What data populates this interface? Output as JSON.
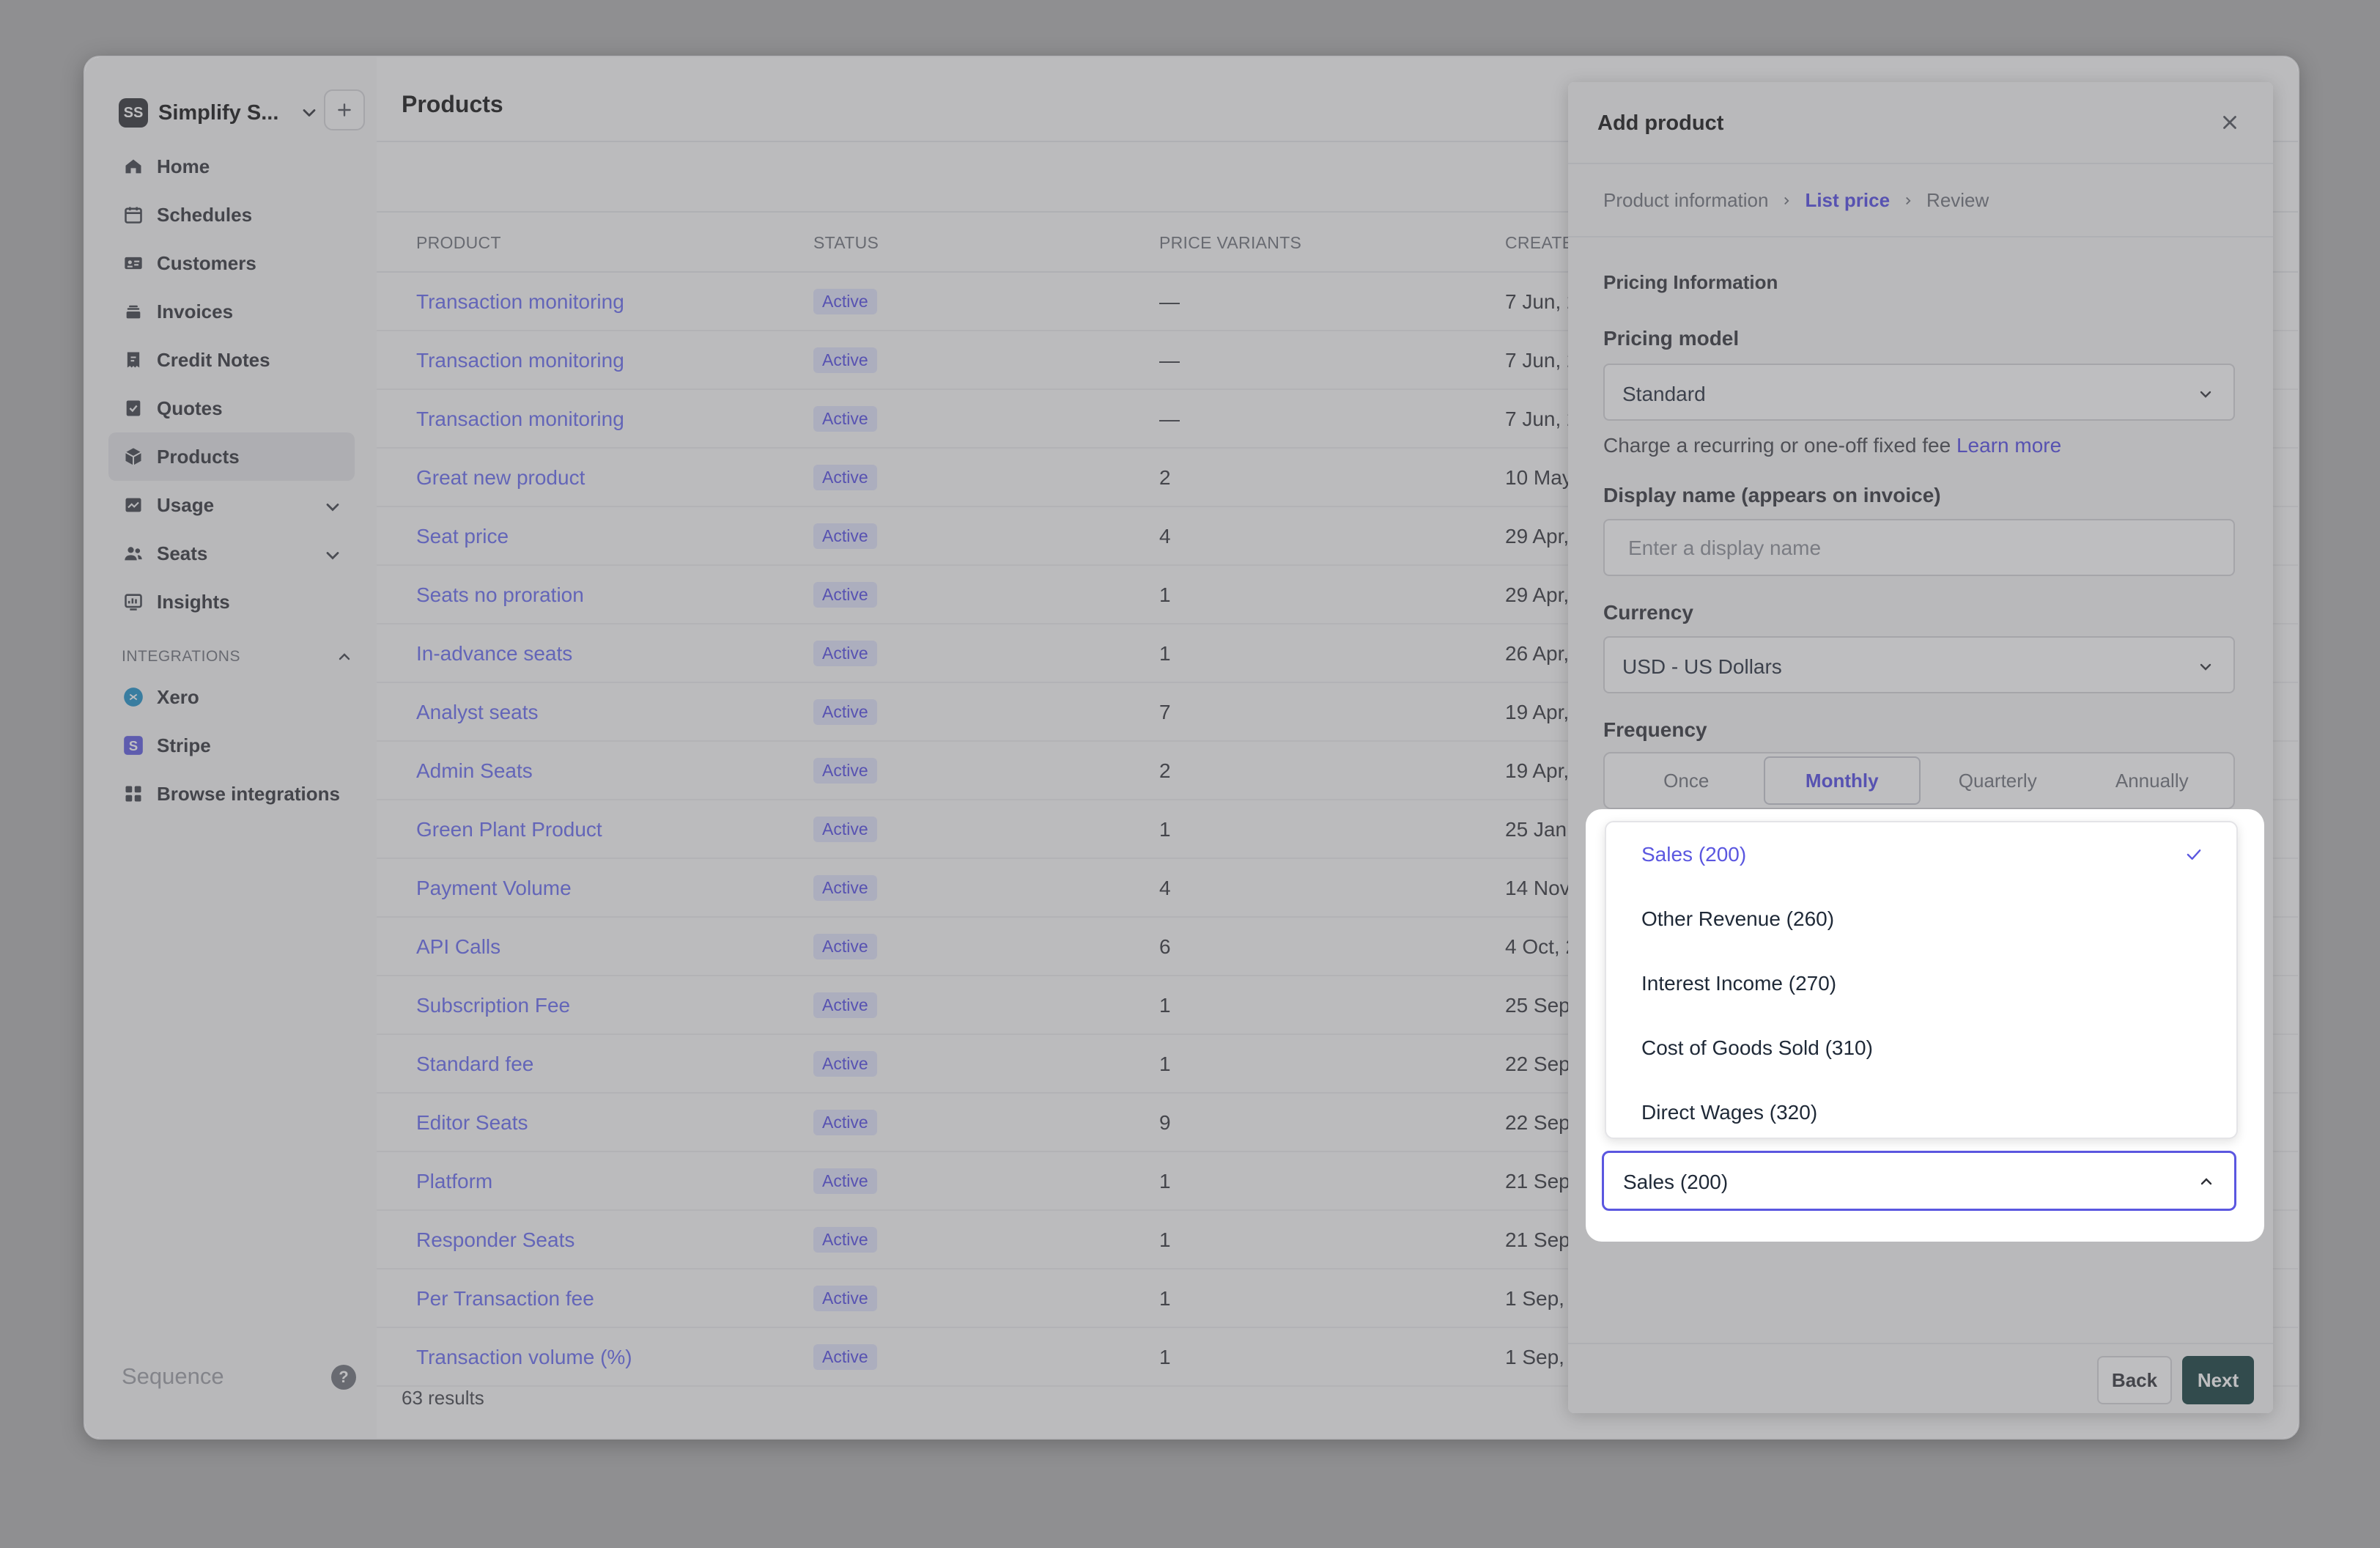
{
  "workspace": {
    "initials": "SS",
    "name": "Simplify S..."
  },
  "sidebar": {
    "items": [
      {
        "label": "Home",
        "icon": "home-icon"
      },
      {
        "label": "Schedules",
        "icon": "calendar-icon"
      },
      {
        "label": "Customers",
        "icon": "id-card-icon"
      },
      {
        "label": "Invoices",
        "icon": "invoice-stack-icon"
      },
      {
        "label": "Credit Notes",
        "icon": "credit-note-icon"
      },
      {
        "label": "Quotes",
        "icon": "quote-check-icon"
      },
      {
        "label": "Products",
        "icon": "cube-icon",
        "active": true
      },
      {
        "label": "Usage",
        "icon": "usage-chart-icon",
        "expandable": true
      },
      {
        "label": "Seats",
        "icon": "users-icon",
        "expandable": true
      },
      {
        "label": "Insights",
        "icon": "insights-icon"
      }
    ],
    "integrations_title": "INTEGRATIONS",
    "integrations": [
      {
        "label": "Xero",
        "icon": "xero-logo-icon"
      },
      {
        "label": "Stripe",
        "icon": "stripe-logo-icon"
      },
      {
        "label": "Browse integrations",
        "icon": "grid-icon"
      }
    ],
    "brand": "Sequence",
    "help": "?"
  },
  "main": {
    "title": "Products",
    "columns": [
      "PRODUCT",
      "STATUS",
      "PRICE VARIANTS",
      "CREATE"
    ],
    "rows": [
      {
        "name": "Transaction monitoring",
        "status": "Active",
        "variants": "—",
        "created": "7 Jun, 2"
      },
      {
        "name": "Transaction monitoring",
        "status": "Active",
        "variants": "—",
        "created": "7 Jun, 2"
      },
      {
        "name": "Transaction monitoring",
        "status": "Active",
        "variants": "—",
        "created": "7 Jun, 2"
      },
      {
        "name": "Great new product",
        "status": "Active",
        "variants": "2",
        "created": "10 May"
      },
      {
        "name": "Seat price",
        "status": "Active",
        "variants": "4",
        "created": "29 Apr,"
      },
      {
        "name": "Seats no proration",
        "status": "Active",
        "variants": "1",
        "created": "29 Apr,"
      },
      {
        "name": "In-advance seats",
        "status": "Active",
        "variants": "1",
        "created": "26 Apr,"
      },
      {
        "name": "Analyst seats",
        "status": "Active",
        "variants": "7",
        "created": "19 Apr,"
      },
      {
        "name": "Admin Seats",
        "status": "Active",
        "variants": "2",
        "created": "19 Apr,"
      },
      {
        "name": "Green Plant Product",
        "status": "Active",
        "variants": "1",
        "created": "25 Jan,"
      },
      {
        "name": "Payment Volume",
        "status": "Active",
        "variants": "4",
        "created": "14 Nov"
      },
      {
        "name": "API Calls",
        "status": "Active",
        "variants": "6",
        "created": "4 Oct, 2"
      },
      {
        "name": "Subscription Fee",
        "status": "Active",
        "variants": "1",
        "created": "25 Sep,"
      },
      {
        "name": "Standard fee",
        "status": "Active",
        "variants": "1",
        "created": "22 Sep,"
      },
      {
        "name": "Editor Seats",
        "status": "Active",
        "variants": "9",
        "created": "22 Sep,"
      },
      {
        "name": "Platform",
        "status": "Active",
        "variants": "1",
        "created": "21 Sep,"
      },
      {
        "name": "Responder Seats",
        "status": "Active",
        "variants": "1",
        "created": "21 Sep,"
      },
      {
        "name": "Per Transaction fee",
        "status": "Active",
        "variants": "1",
        "created": "1 Sep, 2"
      },
      {
        "name": "Transaction volume (%)",
        "status": "Active",
        "variants": "1",
        "created": "1 Sep, 2"
      }
    ],
    "results": "63 results"
  },
  "drawer": {
    "title": "Add product",
    "breadcrumb": [
      "Product information",
      "List price",
      "Review"
    ],
    "section_title": "Pricing Information",
    "pricing_model_label": "Pricing model",
    "pricing_model_value": "Standard",
    "hint_text": "Charge a recurring or one-off fixed fee",
    "hint_link": "Learn more",
    "display_name_label": "Display name (appears on invoice)",
    "display_name_placeholder": "Enter a display name",
    "currency_label": "Currency",
    "currency_value": "USD - US Dollars",
    "frequency_label": "Frequency",
    "frequency_options": [
      "Once",
      "Monthly",
      "Quarterly",
      "Annually"
    ],
    "frequency_selected": "Monthly",
    "back": "Back",
    "next": "Next"
  },
  "account_select": {
    "value": "Sales (200)",
    "options": [
      {
        "label": "Sales (200)",
        "selected": true
      },
      {
        "label": "Other Revenue (260)"
      },
      {
        "label": "Interest Income (270)"
      },
      {
        "label": "Cost of Goods Sold (310)"
      },
      {
        "label": "Direct Wages (320)"
      }
    ]
  },
  "colors": {
    "accent": "#5b57e0",
    "link": "#6366f1",
    "primary_button": "#0f3a3a"
  }
}
